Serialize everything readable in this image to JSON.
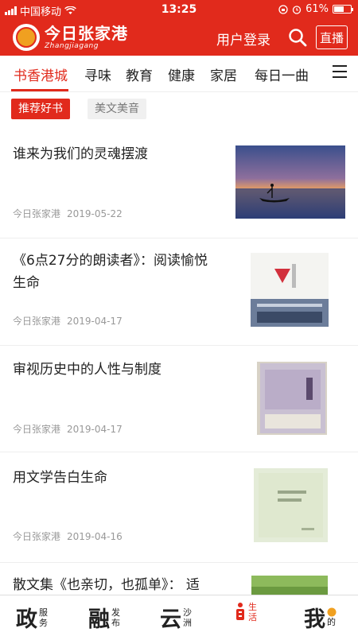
{
  "status_bar": {
    "carrier": "中国移动",
    "time": "13:25",
    "battery": "61%",
    "battery_level": 0.61
  },
  "header": {
    "app_name": "今日张家港",
    "app_subtitle": "Zhangjiagang",
    "login_label": "用户登录",
    "live_label": "直播",
    "brand_color": "#e12a1c"
  },
  "tabs": [
    {
      "label": "书香港城",
      "active": true
    },
    {
      "label": "寻味",
      "active": false
    },
    {
      "label": "教育",
      "active": false
    },
    {
      "label": "健康",
      "active": false
    },
    {
      "label": "家居",
      "active": false
    },
    {
      "label": "每日一曲",
      "active": false
    }
  ],
  "subtabs": [
    {
      "label": "推荐好书",
      "active": true
    },
    {
      "label": "美文美音",
      "active": false
    }
  ],
  "articles": [
    {
      "title": "谁来为我们的灵魂摆渡",
      "source": "今日张家港",
      "date": "2019-05-22"
    },
    {
      "title": "《6点27分的朗读者》：阅读愉悦生命",
      "source": "今日张家港",
      "date": "2019-04-17"
    },
    {
      "title": "审视历史中的人性与制度",
      "source": "今日张家港",
      "date": "2019-04-17"
    },
    {
      "title": "用文学告白生命",
      "source": "今日张家港",
      "date": "2019-04-16"
    },
    {
      "title": "散文集《也亲切，也孤单》： 适",
      "source": "",
      "date": ""
    }
  ],
  "bottom_nav": [
    {
      "big": "政",
      "small1": "服",
      "small2": "务",
      "active": false
    },
    {
      "big": "融",
      "small1": "发",
      "small2": "布",
      "active": false
    },
    {
      "big": "云",
      "small1": "沙",
      "small2": "洲",
      "active": false
    },
    {
      "big": "",
      "small1": "生",
      "small2": "活",
      "active": true
    },
    {
      "big": "我",
      "small1": "的",
      "small2": "",
      "active": false
    }
  ]
}
